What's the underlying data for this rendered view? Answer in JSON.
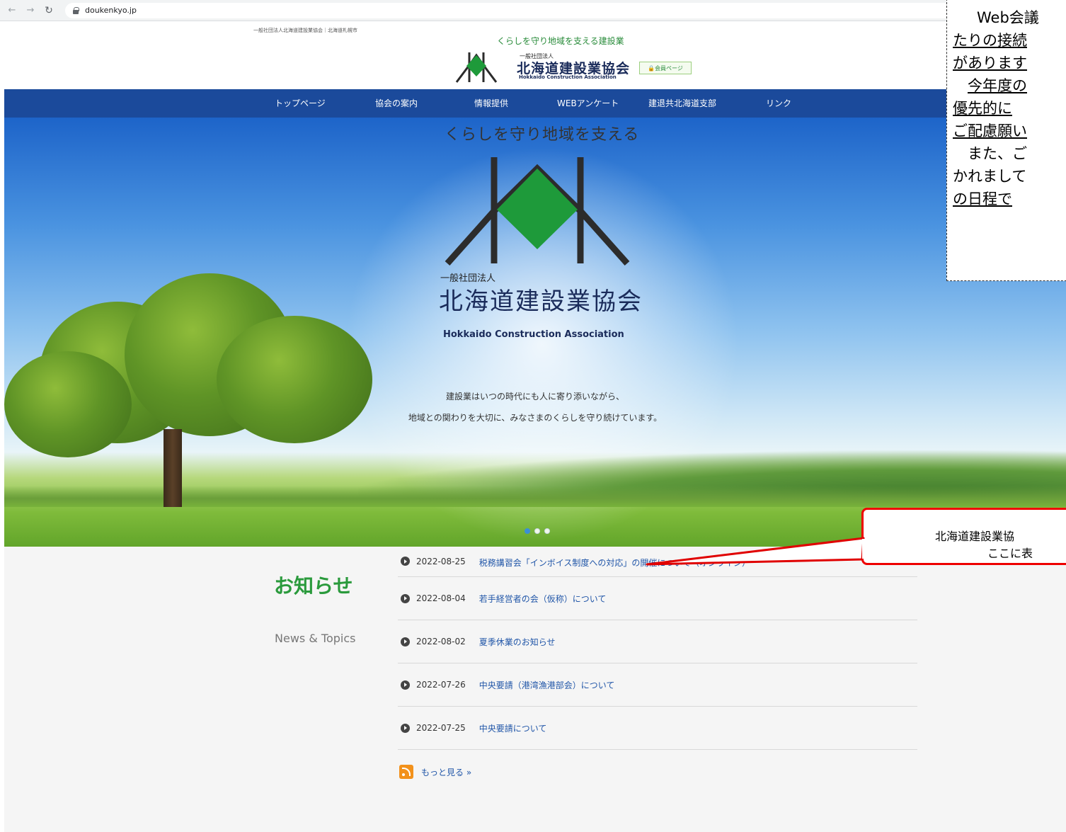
{
  "browser": {
    "url": "doukenkyo.jp"
  },
  "site": {
    "small_tagline": "一般社団法人北海道建設業協会｜北海道札幌市",
    "catch": "くらしを守り地域を支える建設業",
    "logo_sub": "一般社団法人",
    "logo_name": "北海道建設業協会",
    "logo_en": "Hokkaido Construction Association",
    "member_link": "会員ページ"
  },
  "nav": {
    "items": [
      {
        "label": "トップページ"
      },
      {
        "label": "協会の案内"
      },
      {
        "label": "情報提供"
      },
      {
        "label": "WEBアンケート"
      },
      {
        "label": "建退共北海道支部"
      },
      {
        "label": "リンク"
      }
    ]
  },
  "hero": {
    "catch": "くらしを守り地域を支える",
    "org_sub": "一般社団法人",
    "org_name": "北海道建設業協会",
    "org_en": "Hokkaido Construction Association",
    "line1": "建設業はいつの時代にも人に寄り添いながら、",
    "line2": "地域との関わりを大切に、みなさまのくらしを守り続けています。",
    "active_slide": 1,
    "slide_count": 3
  },
  "news": {
    "heading": "お知らせ",
    "subheading": "News & Topics",
    "items": [
      {
        "date": "2022-08-25",
        "title": "税務講習会「インボイス制度への対応」の開催について（オンライン）"
      },
      {
        "date": "2022-08-04",
        "title": "若手経営者の会（仮称）について"
      },
      {
        "date": "2022-08-02",
        "title": "夏季休業のお知らせ"
      },
      {
        "date": "2022-07-26",
        "title": "中央要請（港湾漁港部会）について"
      },
      {
        "date": "2022-07-25",
        "title": "中央要請について"
      }
    ],
    "more_label": "もっと見る »"
  },
  "notice": {
    "lines": [
      "Web会議",
      "たりの接続",
      "があります",
      "今年度の",
      "優先的に",
      "ご配慮願い",
      "また、ご",
      "かれまして",
      "の日程で"
    ]
  },
  "callout": {
    "line1": "北海道建設業協",
    "line2": "ここに表"
  },
  "colors": {
    "nav_bg": "#1b4a9b",
    "brand_green": "#2a9a3c",
    "link": "#2156a8",
    "callout_red": "#e00000"
  }
}
